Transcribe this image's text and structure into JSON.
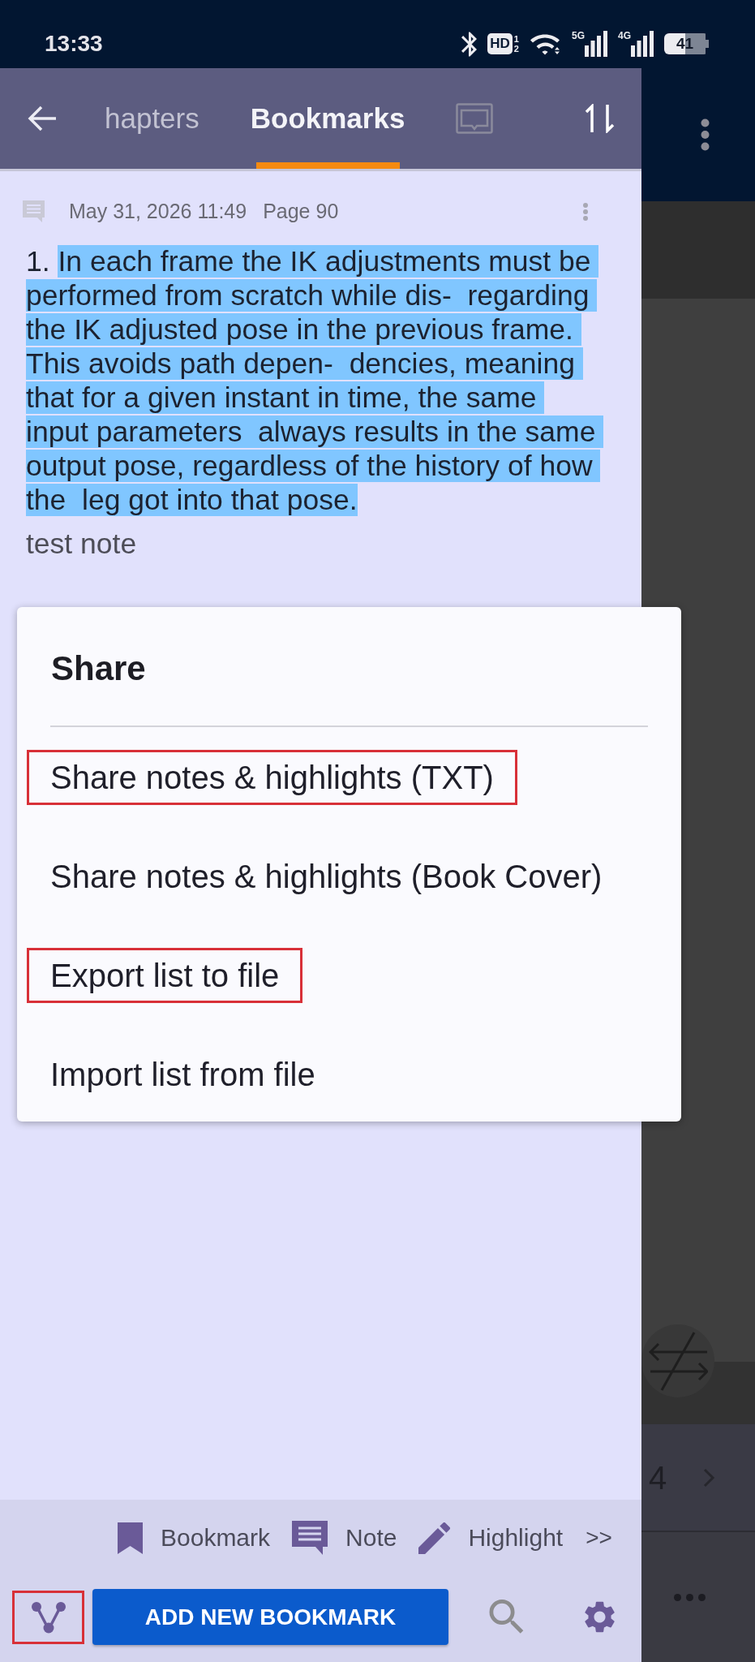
{
  "status_bar": {
    "time": "13:33",
    "hd_badge": "HD",
    "hd_slots": [
      "1",
      "2"
    ],
    "networks": [
      "5G",
      "4G"
    ],
    "battery": "41"
  },
  "drawer": {
    "tabs": [
      {
        "kind": "text",
        "label": "hapters",
        "selected": false
      },
      {
        "kind": "text",
        "label": "Bookmarks",
        "selected": true
      },
      {
        "kind": "icon",
        "selected": false
      }
    ],
    "bookmark": {
      "date": "May 31, 2026 11:49",
      "page": "Page 90",
      "number": "1.",
      "highlight": "In each frame the IK adjustments must be performed from scratch while dis-  regarding the IK adjusted pose in the previous frame. This avoids path depen-  dencies, meaning that for a given instant in time, the same input parameters  always results in the same output pose, regardless of the history of how the  leg got into that pose.",
      "note": "test note"
    },
    "actions": [
      {
        "kind": "bookmark",
        "label": "Bookmark"
      },
      {
        "kind": "note",
        "label": "Note"
      },
      {
        "kind": "highlight",
        "label": "Highlight"
      }
    ],
    "more": ">>",
    "branch_button": {
      "annotated": true
    },
    "add_button": "ADD NEW BOOKMARK"
  },
  "share_dialog": {
    "title": "Share",
    "items": [
      {
        "label": "Share notes & highlights (TXT)",
        "annotated": true
      },
      {
        "label": "Share notes & highlights (Book Cover)",
        "annotated": false
      },
      {
        "label": "Export list to file",
        "annotated": true
      },
      {
        "label": "Import list from file",
        "annotated": false
      }
    ]
  },
  "reader": {
    "page_number": "4"
  }
}
